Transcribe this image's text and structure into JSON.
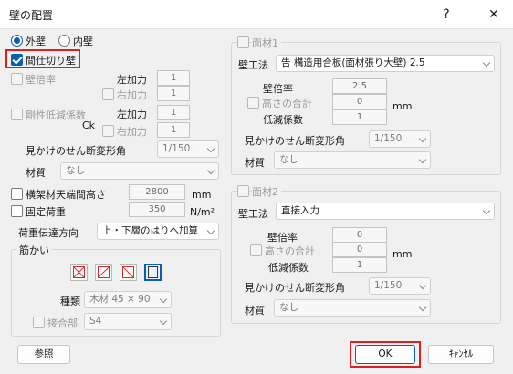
{
  "window": {
    "title": "壁の配置",
    "help_glyph": "?",
    "close_glyph": "✕"
  },
  "left": {
    "outer_wall": "外壁",
    "inner_wall": "内壁",
    "partition_wall": "間仕切り壁",
    "wall_ratio": "壁倍率",
    "left_force": "左加力",
    "right_force": "右加力",
    "wall_ratio_left_value": "1",
    "wall_ratio_right_value": "1",
    "stiffness_reduction": "剛性低減係数",
    "ck": "Ck",
    "stiff_left_value": "1",
    "stiff_right_value": "1",
    "apparent_shear": "見かけのせん断変形角",
    "apparent_shear_value": "1/150",
    "material": "材質",
    "material_value": "なし",
    "beam_top_height": "横架材天端間高さ",
    "beam_top_height_value": "2800",
    "mm": "mm",
    "fixed_load": "固定荷重",
    "fixed_load_value": "350",
    "nm2": "N/m²",
    "load_transfer": "荷重伝達方向",
    "load_transfer_value": "上・下層のはりへ加算",
    "brace_group": "筋かい",
    "type_label": "種類",
    "type_value": "木材 45 × 90",
    "joint_label": "接合部",
    "joint_value": "S4"
  },
  "face1": {
    "title": "面材1",
    "method_label": "壁工法",
    "method_value": "告 構造用合板(面材張り大壁) 2.5",
    "ratio_label": "壁倍率",
    "ratio_value": "2.5",
    "height_sum_label": "高さの合計",
    "height_sum_value": "0",
    "mm": "mm",
    "reduction_label": "低減係数",
    "reduction_value": "1",
    "shear_label": "見かけのせん断変形角",
    "shear_value": "1/150",
    "material_label": "材質",
    "material_value": "なし"
  },
  "face2": {
    "title": "面材2",
    "method_label": "壁工法",
    "method_value": "直接入力",
    "ratio_label": "壁倍率",
    "ratio_value": "0",
    "height_sum_label": "高さの合計",
    "height_sum_value": "0",
    "mm": "mm",
    "reduction_label": "低減係数",
    "reduction_value": "1",
    "shear_label": "見かけのせん断変形角",
    "shear_value": "1/150",
    "material_label": "材質",
    "material_value": "なし"
  },
  "footer": {
    "browse": "参照",
    "ok": "OK",
    "cancel": "ｷｬﾝｾﾙ"
  },
  "colors": {
    "accent": "#0a5fb4",
    "highlight": "#e02020",
    "brace_red": "#d03030"
  }
}
